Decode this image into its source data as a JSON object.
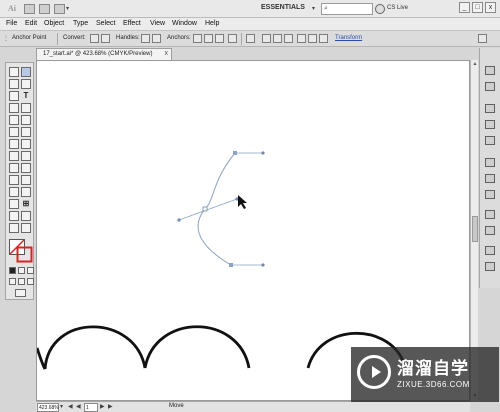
{
  "app": {
    "logo_text": "Ai",
    "workspace": "ESSENTIALS",
    "cs_live": "CS Live"
  },
  "window_controls": {
    "minimize": "_",
    "maximize": "□",
    "close": "x"
  },
  "menu": [
    "File",
    "Edit",
    "Object",
    "Type",
    "Select",
    "Effect",
    "View",
    "Window",
    "Help"
  ],
  "control_bar": {
    "mode": "Anchor Point",
    "convert": "Convert:",
    "handles": "Handles:",
    "anchors": "Anchors:",
    "transform": "Transform"
  },
  "document_tab": {
    "title": "17_start.ai* @ 423.68% (CMYK/Preview)",
    "close": "x"
  },
  "status_bar": {
    "zoom": "423.68%",
    "artboard": "1",
    "tool_label": "Move"
  },
  "tools": {
    "type_tool": "T",
    "graph_tool": "⊞"
  },
  "watermark": {
    "title": "溜溜自学",
    "url": "ZIXUE.3D66.COM"
  },
  "colors": {
    "canvas": "#ffffff",
    "path_stroke": "#8aa4c2",
    "shape_stroke": "#111111"
  }
}
